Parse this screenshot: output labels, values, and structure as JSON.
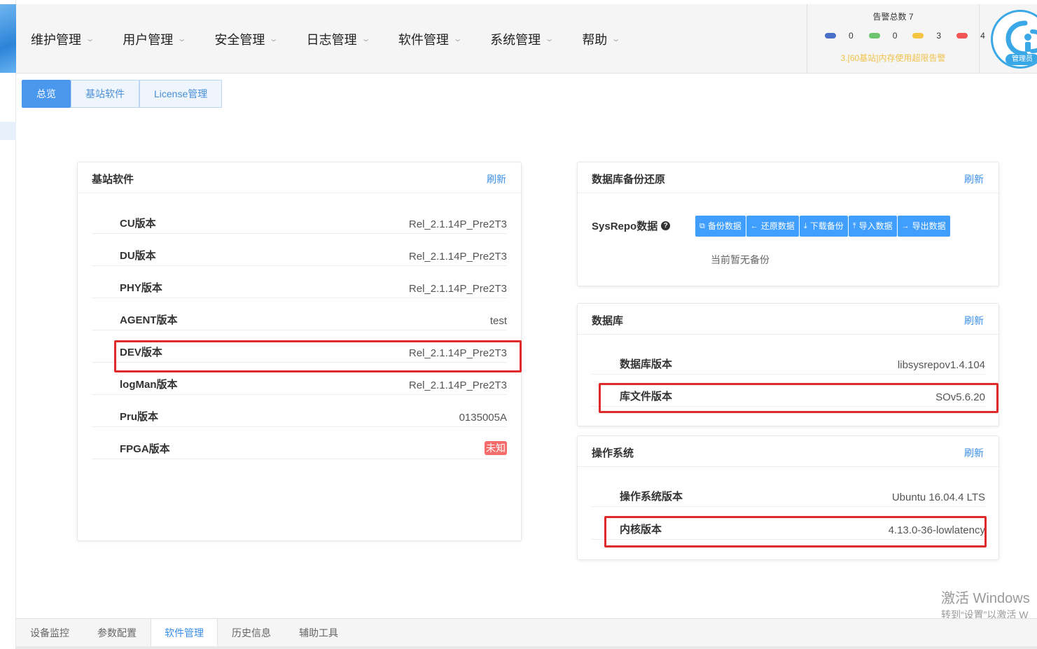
{
  "header": {
    "nav": [
      {
        "label": "维护管理"
      },
      {
        "label": "用户管理"
      },
      {
        "label": "安全管理"
      },
      {
        "label": "日志管理"
      },
      {
        "label": "软件管理"
      },
      {
        "label": "系统管理"
      },
      {
        "label": "帮助"
      }
    ],
    "alarm": {
      "title": "告警总数 7",
      "counts": [
        {
          "color": "#4a6fc7",
          "value": "0"
        },
        {
          "color": "#6cc56c",
          "value": "0"
        },
        {
          "color": "#f5c542",
          "value": "3"
        },
        {
          "color": "#f05454",
          "value": "4"
        }
      ],
      "message": "3.[60基站]内存使用超限告警"
    },
    "user_role": "管理员"
  },
  "top_tabs": [
    "总览",
    "基站软件",
    "License管理"
  ],
  "base_software": {
    "title": "基站软件",
    "refresh": "刷新",
    "rows": [
      {
        "label": "CU版本",
        "value": "Rel_2.1.14P_Pre2T3"
      },
      {
        "label": "DU版本",
        "value": "Rel_2.1.14P_Pre2T3"
      },
      {
        "label": "PHY版本",
        "value": "Rel_2.1.14P_Pre2T3"
      },
      {
        "label": "AGENT版本",
        "value": "test"
      },
      {
        "label": "DEV版本",
        "value": "Rel_2.1.14P_Pre2T3"
      },
      {
        "label": "logMan版本",
        "value": "Rel_2.1.14P_Pre2T3"
      },
      {
        "label": "Pru版本",
        "value": "0135005A"
      },
      {
        "label": "FPGA版本",
        "value": "未知"
      }
    ]
  },
  "db_backup": {
    "title": "数据库备份还原",
    "refresh": "刷新",
    "sysrepo_label": "SysRepo数据",
    "buttons": [
      "备份数据",
      "还原数据",
      "下载备份",
      "导入数据",
      "导出数据"
    ],
    "empty_text": "当前暂无备份"
  },
  "database": {
    "title": "数据库",
    "refresh": "刷新",
    "rows": [
      {
        "label": "数据库版本",
        "value": "libsysrepov1.4.104"
      },
      {
        "label": "库文件版本",
        "value": "SOv5.6.20"
      }
    ]
  },
  "os": {
    "title": "操作系统",
    "refresh": "刷新",
    "rows": [
      {
        "label": "操作系统版本",
        "value": "Ubuntu 16.04.4 LTS"
      },
      {
        "label": "内核版本",
        "value": "4.13.0-36-lowlatency"
      }
    ]
  },
  "bottom_tabs": [
    "设备监控",
    "参数配置",
    "软件管理",
    "历史信息",
    "辅助工具"
  ],
  "watermark": {
    "line1": "激活 Windows",
    "line2": "转到“设置”以激活 W"
  }
}
